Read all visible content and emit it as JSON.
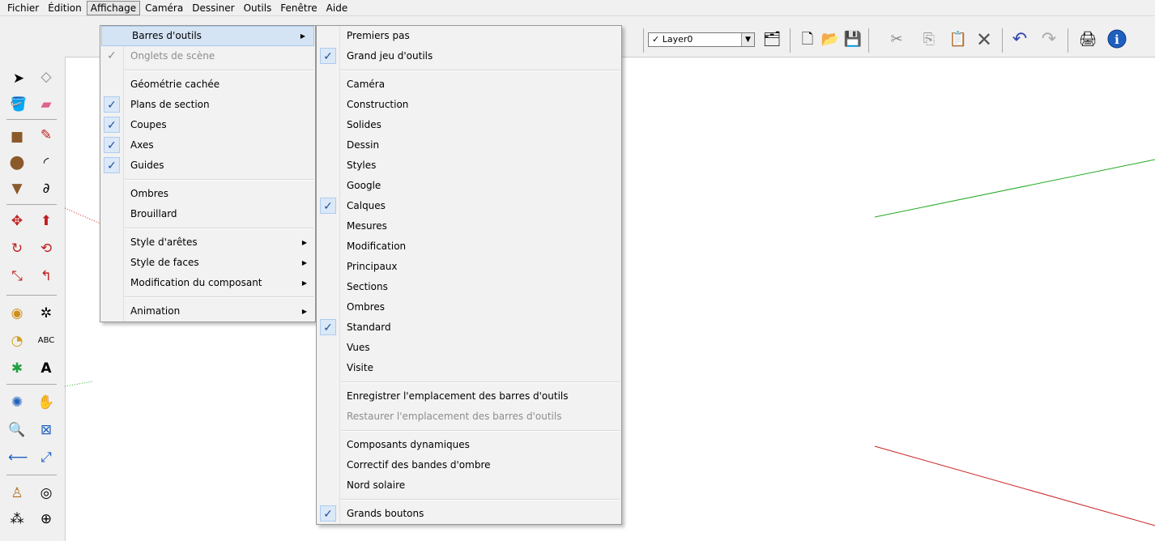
{
  "menubar": {
    "items": [
      {
        "label": "Fichier"
      },
      {
        "label": "Édition"
      },
      {
        "label": "Affichage"
      },
      {
        "label": "Caméra"
      },
      {
        "label": "Dessiner"
      },
      {
        "label": "Outils"
      },
      {
        "label": "Fenêtre"
      },
      {
        "label": "Aide"
      }
    ],
    "active": "Affichage"
  },
  "toolbar": {
    "layer_check": "✓",
    "layer_name": "Layer0",
    "icons": [
      "layer-manager-icon",
      "new-icon",
      "open-icon",
      "save-icon",
      "cut-icon",
      "copy-icon",
      "paste-icon",
      "erase-icon",
      "undo-icon",
      "redo-icon",
      "print-icon",
      "model-info-icon"
    ]
  },
  "affichage_menu": {
    "items": [
      {
        "label": "Barres d'outils",
        "checked": false,
        "submenu": true,
        "highlighted": true
      },
      {
        "label": "Onglets de scène",
        "checked": true,
        "disabled": true
      },
      {
        "sep": true
      },
      {
        "label": "Géométrie cachée",
        "checked": false
      },
      {
        "label": "Plans de section",
        "checked": true
      },
      {
        "label": "Coupes",
        "checked": true
      },
      {
        "label": "Axes",
        "checked": true
      },
      {
        "label": "Guides",
        "checked": true
      },
      {
        "sep": true
      },
      {
        "label": "Ombres",
        "checked": false
      },
      {
        "label": "Brouillard",
        "checked": false
      },
      {
        "sep": true
      },
      {
        "label": "Style d'arêtes",
        "submenu": true
      },
      {
        "label": "Style de faces",
        "submenu": true
      },
      {
        "label": "Modification du composant",
        "submenu": true
      },
      {
        "sep": true
      },
      {
        "label": "Animation",
        "submenu": true
      }
    ]
  },
  "toolbars_submenu": {
    "items": [
      {
        "label": "Premiers pas",
        "checked": false
      },
      {
        "label": "Grand jeu d'outils",
        "checked": true
      },
      {
        "sep": true
      },
      {
        "label": "Caméra",
        "checked": false
      },
      {
        "label": "Construction",
        "checked": false
      },
      {
        "label": "Solides",
        "checked": false
      },
      {
        "label": "Dessin",
        "checked": false
      },
      {
        "label": "Styles",
        "checked": false
      },
      {
        "label": "Google",
        "checked": false
      },
      {
        "label": "Calques",
        "checked": true
      },
      {
        "label": "Mesures",
        "checked": false
      },
      {
        "label": "Modification",
        "checked": false
      },
      {
        "label": "Principaux",
        "checked": false
      },
      {
        "label": "Sections",
        "checked": false
      },
      {
        "label": "Ombres",
        "checked": false
      },
      {
        "label": "Standard",
        "checked": true
      },
      {
        "label": "Vues",
        "checked": false
      },
      {
        "label": "Visite",
        "checked": false
      },
      {
        "sep": true
      },
      {
        "label": "Enregistrer l'emplacement des barres d'outils",
        "checked": false
      },
      {
        "label": "Restaurer l'emplacement des barres d'outils",
        "checked": false,
        "disabled": true
      },
      {
        "sep": true
      },
      {
        "label": "Composants dynamiques",
        "checked": false
      },
      {
        "label": "Correctif des bandes d'ombre",
        "checked": false
      },
      {
        "label": "Nord solaire",
        "checked": false
      },
      {
        "sep": true
      },
      {
        "label": "Grands boutons",
        "checked": true
      }
    ]
  },
  "check_glyph": "✓",
  "arrow_glyph": "▶",
  "colors": {
    "axis_green": "#22aa22",
    "axis_red": "#cc2222",
    "check_blue": "#1f4d9e",
    "highlight": "#d5e4f5"
  }
}
